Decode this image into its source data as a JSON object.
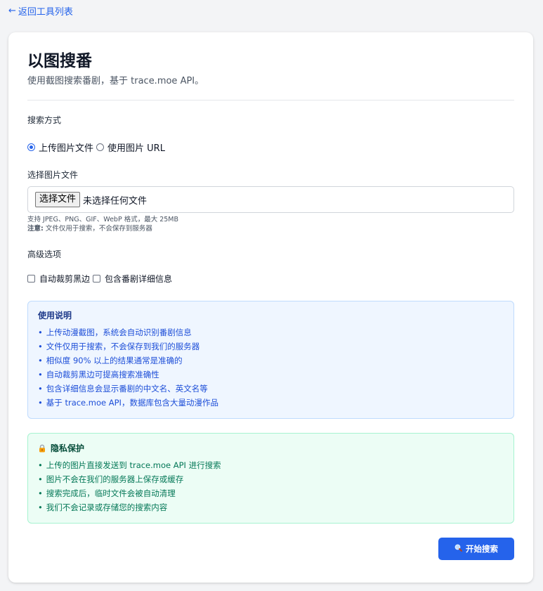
{
  "back_link": {
    "arrow": "←",
    "label": "返回工具列表"
  },
  "header": {
    "title": "以图搜番",
    "subtitle": "使用截图搜索番剧，基于 trace.moe API。"
  },
  "search_method": {
    "label": "搜索方式",
    "options": [
      {
        "label": "上传图片文件",
        "checked": true
      },
      {
        "label": "使用图片 URL",
        "checked": false
      }
    ]
  },
  "file_select": {
    "label": "选择图片文件",
    "button_label": "选择文件",
    "status": "未选择任何文件",
    "hint_formats": "支持 JPEG、PNG、GIF、WebP 格式，最大 25MB",
    "hint_note_prefix": "注意:",
    "hint_note_text": " 文件仅用于搜索，不会保存到服务器"
  },
  "advanced": {
    "label": "高级选项",
    "options": [
      {
        "label": "自动裁剪黑边",
        "checked": false
      },
      {
        "label": "包含番剧详细信息",
        "checked": false
      }
    ]
  },
  "usage_info": {
    "title": "使用说明",
    "items": [
      "上传动漫截图，系统会自动识别番剧信息",
      "文件仅用于搜索，不会保存到我们的服务器",
      "相似度 90% 以上的结果通常是准确的",
      "自动裁剪黑边可提高搜索准确性",
      "包含详细信息会显示番剧的中文名、英文名等",
      "基于 trace.moe API，数据库包含大量动漫作品"
    ]
  },
  "privacy": {
    "icon": "lock-icon",
    "title": "隐私保护",
    "items": [
      "上传的图片直接发送到 trace.moe API 进行搜索",
      "图片不会在我们的服务器上保存或缓存",
      "搜索完成后，临时文件会被自动清理",
      "我们不会记录或存储您的搜索内容"
    ]
  },
  "submit": {
    "icon": "magnifier-icon",
    "label": "开始搜索"
  },
  "colors": {
    "accent": "#2563eb",
    "info_bg": "#eff6ff",
    "privacy_bg": "#ecfdf5"
  }
}
